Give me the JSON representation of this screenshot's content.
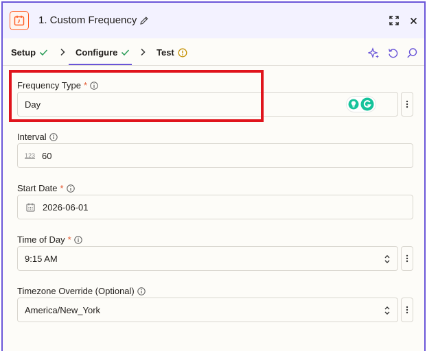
{
  "header": {
    "title": "1. Custom Frequency",
    "icons": {
      "app": "calendar-clock-icon",
      "edit": "pencil-icon",
      "expand": "expand-icon",
      "close": "close-icon"
    }
  },
  "tabs": [
    {
      "label": "Setup",
      "status": "complete",
      "active": false
    },
    {
      "label": "Configure",
      "status": "complete",
      "active": true
    },
    {
      "label": "Test",
      "status": "warning",
      "active": false
    }
  ],
  "toolbar_icons": [
    "sparkle-icon",
    "refresh-icon",
    "search-icon"
  ],
  "fields": {
    "frequency_type": {
      "label": "Frequency Type",
      "required": "*",
      "value": "Day"
    },
    "interval": {
      "label": "Interval",
      "value": "60",
      "type_badge": "123"
    },
    "start_date": {
      "label": "Start Date",
      "required": "*",
      "value": "2026-06-01"
    },
    "time_of_day": {
      "label": "Time of Day",
      "required": "*",
      "value": "9:15 AM"
    },
    "timezone": {
      "label": "Timezone Override (Optional)",
      "value": "America/New_York"
    }
  },
  "colors": {
    "accent": "#6a55d8",
    "brand_orange": "#ff5a1f",
    "success": "#2e9e5b",
    "warning": "#c49000",
    "required": "#e4572e",
    "highlight": "#e0141c",
    "grammarly": "#15c39a"
  }
}
